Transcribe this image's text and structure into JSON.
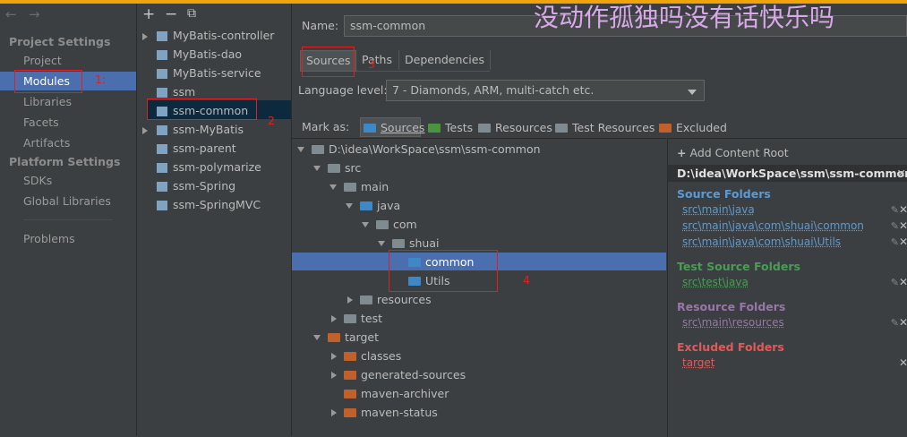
{
  "nav": {
    "back": "←",
    "forward": "→"
  },
  "left": {
    "project_settings": "Project Settings",
    "items_project": [
      "Project",
      "Modules",
      "Libraries",
      "Facets",
      "Artifacts"
    ],
    "platform_settings": "Platform Settings",
    "items_platform": [
      "SDKs",
      "Global Libraries"
    ],
    "problems": "Problems"
  },
  "modules_toolbar": {
    "add": "+",
    "remove": "−",
    "copy": "⧉"
  },
  "modules": [
    "MyBatis-controller",
    "MyBatis-dao",
    "MyBatis-service",
    "ssm",
    "ssm-common",
    "ssm-MyBatis",
    "ssm-parent",
    "ssm-polymarize",
    "ssm-Spring",
    "ssm-SpringMVC"
  ],
  "annotations": {
    "n1": "1:",
    "n2": "2",
    "n3": "3",
    "n4": "4"
  },
  "overlay_text": "没动作孤独吗没有话快乐吗",
  "detail": {
    "name_label": "Name:",
    "name_value": "ssm-common",
    "tabs": [
      "Sources",
      "Paths",
      "Dependencies"
    ],
    "language_label": "Language level:",
    "language_value": "7 - Diamonds, ARM, multi-catch etc.",
    "mark_as_label": "Mark as:",
    "mark_as": [
      "Sources",
      "Tests",
      "Resources",
      "Test Resources",
      "Excluded"
    ]
  },
  "tree": [
    {
      "label": "D:\\idea\\WorkSpace\\ssm\\ssm-common"
    },
    {
      "label": "src"
    },
    {
      "label": "main"
    },
    {
      "label": "java"
    },
    {
      "label": "com"
    },
    {
      "label": "shuai"
    },
    {
      "label": "common"
    },
    {
      "label": "Utils"
    },
    {
      "label": "resources"
    },
    {
      "label": "test"
    },
    {
      "label": "target"
    },
    {
      "label": "classes"
    },
    {
      "label": "generated-sources"
    },
    {
      "label": "maven-archiver"
    },
    {
      "label": "maven-status"
    }
  ],
  "roots": {
    "add_content_root": "Add Content Root",
    "root_path": "D:\\idea\\WorkSpace\\ssm\\ssm-common",
    "source_folders_title": "Source Folders",
    "source_folders": [
      "src\\main\\java",
      "src\\main\\java\\com\\shuai\\common",
      "src\\main\\java\\com\\shuai\\Utils"
    ],
    "test_source_title": "Test Source Folders",
    "test_source": [
      "src\\test\\java"
    ],
    "resource_title": "Resource Folders",
    "resource": [
      "src\\main\\resources"
    ],
    "excluded_title": "Excluded Folders",
    "excluded": [
      "target"
    ]
  },
  "colors": {
    "source": "#5a9bd5",
    "test": "#499c54",
    "resource": "#9876aa",
    "excluded": "#e05a5a",
    "selection": "#4b6eaf"
  }
}
